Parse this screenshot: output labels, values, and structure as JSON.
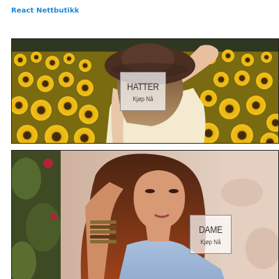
{
  "header": {
    "brand": "React Nettbutikk"
  },
  "categories": [
    {
      "title": "HATTER",
      "action": "Kjøp Nå"
    },
    {
      "title": "DAME",
      "action": "Kjøp Nå"
    }
  ],
  "colors": {
    "brand": "#1e88d6"
  }
}
